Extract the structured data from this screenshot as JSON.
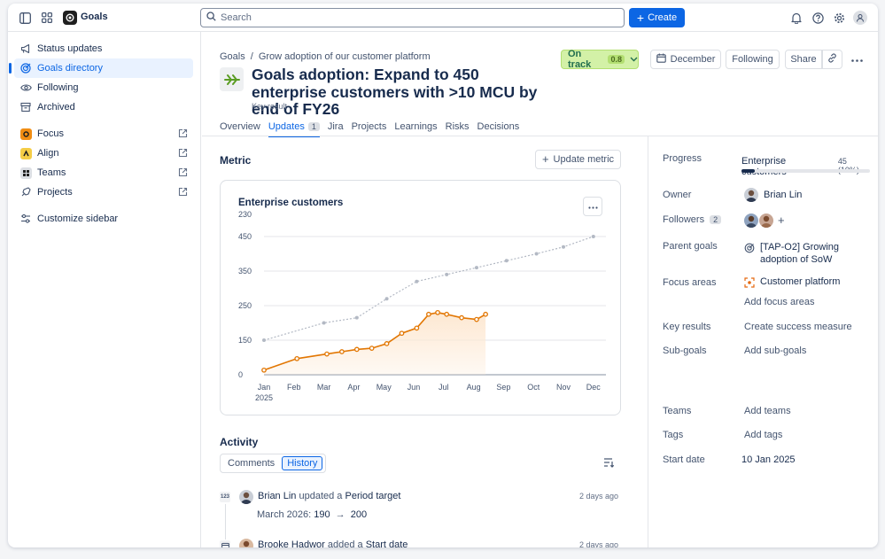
{
  "app": {
    "name": "Goals"
  },
  "search": {
    "placeholder": "Search"
  },
  "header": {
    "create_label": "Create"
  },
  "sidebar": {
    "items": [
      {
        "label": "Status updates",
        "icon": "megaphone-icon"
      },
      {
        "label": "Goals directory",
        "icon": "target-icon",
        "active": true
      },
      {
        "label": "Following",
        "icon": "eye-icon"
      },
      {
        "label": "Archived",
        "icon": "archive-icon"
      },
      {
        "label": "Focus",
        "icon": "focus-app-icon",
        "external": true
      },
      {
        "label": "Align",
        "icon": "align-app-icon",
        "external": true
      },
      {
        "label": "Teams",
        "icon": "teams-icon",
        "external": true
      },
      {
        "label": "Projects",
        "icon": "projects-icon",
        "external": true
      },
      {
        "label": "Customize sidebar",
        "icon": "sliders-icon"
      }
    ]
  },
  "goal": {
    "breadcrumb": [
      "Goals",
      "/",
      "Grow adoption of our customer platform"
    ],
    "title": "Goals adoption: Expand to 450 enterprise customers with >10 MCU by end of FY26",
    "subtitle": "Key result",
    "status": {
      "label": "On track",
      "score": "0.8"
    },
    "month": "December",
    "following": "Following",
    "share": "Share"
  },
  "tabs": [
    {
      "label": "Overview"
    },
    {
      "label": "Updates",
      "count": "1",
      "active": true
    },
    {
      "label": "Jira"
    },
    {
      "label": "Projects"
    },
    {
      "label": "Learnings"
    },
    {
      "label": "Risks"
    },
    {
      "label": "Decisions"
    }
  ],
  "metric": {
    "title": "Metric",
    "update_label": "Update metric",
    "card_title": "Enterprise customers",
    "card_sub": "230"
  },
  "chart_data": {
    "type": "line",
    "title": "Enterprise customers",
    "subtitle": "230",
    "x_ticks": [
      "Jan",
      "Feb",
      "Mar",
      "Apr",
      "May",
      "Jun",
      "Jul",
      "Aug",
      "Sep",
      "Oct",
      "Nov",
      "Dec"
    ],
    "x_sublabel": "2025",
    "y_ticks": [
      0,
      150,
      250,
      350,
      450
    ],
    "ylim": [
      0,
      450
    ],
    "grid": true,
    "series": [
      {
        "style": "dashed-target",
        "color": "#b3b9c4",
        "points": [
          {
            "m": 0.0,
            "v": 150
          },
          {
            "m": 2.0,
            "v": 200
          },
          {
            "m": 3.1,
            "v": 215
          },
          {
            "m": 4.1,
            "v": 270
          },
          {
            "m": 5.1,
            "v": 320
          },
          {
            "m": 6.1,
            "v": 340
          },
          {
            "m": 7.1,
            "v": 360
          },
          {
            "m": 8.1,
            "v": 380
          },
          {
            "m": 9.1,
            "v": 400
          },
          {
            "m": 10.0,
            "v": 420
          },
          {
            "m": 11.0,
            "v": 450
          }
        ]
      },
      {
        "style": "solid-actual",
        "color": "#e27602",
        "fill": "#fde8d2",
        "points": [
          {
            "m": 0.0,
            "v": 20
          },
          {
            "m": 1.1,
            "v": 70
          },
          {
            "m": 2.1,
            "v": 90
          },
          {
            "m": 2.6,
            "v": 100
          },
          {
            "m": 3.1,
            "v": 110
          },
          {
            "m": 3.6,
            "v": 115
          },
          {
            "m": 4.1,
            "v": 135
          },
          {
            "m": 4.6,
            "v": 170
          },
          {
            "m": 5.1,
            "v": 185
          },
          {
            "m": 5.5,
            "v": 225
          },
          {
            "m": 5.8,
            "v": 230
          },
          {
            "m": 6.1,
            "v": 225
          },
          {
            "m": 6.6,
            "v": 215
          },
          {
            "m": 7.1,
            "v": 210
          },
          {
            "m": 7.4,
            "v": 225
          }
        ]
      }
    ]
  },
  "activity": {
    "title": "Activity",
    "tabs": [
      {
        "label": "Comments"
      },
      {
        "label": "History",
        "active": true
      }
    ],
    "entries": [
      {
        "icon_text": "123",
        "user": "Brian Lin",
        "action": "updated a",
        "target": "Period target",
        "time": "2 days ago",
        "detail_label": "March 2026:",
        "detail_from": "190",
        "detail_arrow": "→",
        "detail_to": "200"
      },
      {
        "user": "Brooke Hadwor",
        "action": "added a",
        "target": "Start date",
        "time": "2 days ago"
      }
    ]
  },
  "details": {
    "progress_label": "Progress",
    "progress_name": "Enterprise customers",
    "progress_value": "45 (10%)",
    "progress_fraction": 0.1,
    "owner_label": "Owner",
    "owner": "Brian Lin",
    "followers_label": "Followers",
    "followers_count": "2",
    "parent_label": "Parent goals",
    "parent_goal": "[TAP-O2] Growing adoption of SoW",
    "focus_label": "Focus areas",
    "focus_area": "Customer platform",
    "add_focus": "Add focus areas",
    "key_results_label": "Key results",
    "create_measure": "Create success measure",
    "subgoals_label": "Sub-goals",
    "add_subgoals": "Add sub-goals",
    "teams_label": "Teams",
    "add_teams": "Add teams",
    "tags_label": "Tags",
    "add_tags": "Add tags",
    "start_label": "Start date",
    "start_date": "10 Jan 2025"
  }
}
